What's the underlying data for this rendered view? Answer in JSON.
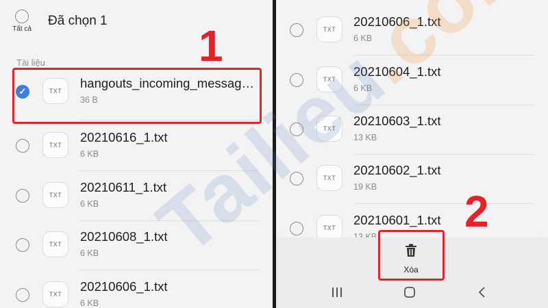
{
  "left": {
    "select_all_label": "Tất cả",
    "header_title": "Đã chọn 1",
    "section_label": "Tài liệu",
    "files": [
      {
        "name": "hangouts_incoming_messag…",
        "size": "36 B",
        "selected": true,
        "type": "TXT"
      },
      {
        "name": "20210616_1.txt",
        "size": "6 KB",
        "selected": false,
        "type": "TXT"
      },
      {
        "name": "20210611_1.txt",
        "size": "6 KB",
        "selected": false,
        "type": "TXT"
      },
      {
        "name": "20210608_1.txt",
        "size": "6 KB",
        "selected": false,
        "type": "TXT"
      },
      {
        "name": "20210606_1.txt",
        "size": "6 KB",
        "selected": false,
        "type": "TXT"
      }
    ]
  },
  "right": {
    "files": [
      {
        "name": "20210606_1.txt",
        "size": "6 KB",
        "type": "TXT"
      },
      {
        "name": "20210604_1.txt",
        "size": "6 KB",
        "type": "TXT"
      },
      {
        "name": "20210603_1.txt",
        "size": "13 KB",
        "type": "TXT"
      },
      {
        "name": "20210602_1.txt",
        "size": "19 KB",
        "type": "TXT"
      },
      {
        "name": "20210601_1.txt",
        "size": "13 KB",
        "type": "TXT"
      }
    ],
    "delete_label": "Xóa"
  },
  "annotations": {
    "step1": "1",
    "step2": "2",
    "highlight_color": "#e5212a"
  },
  "watermark": {
    "text_main": "Tailieu",
    "text_accent": ".com"
  },
  "icons": {
    "check": "check-icon",
    "delete": "trash-icon",
    "nav_recents": "recents-icon",
    "nav_home": "home-icon",
    "nav_back": "back-icon"
  },
  "colors": {
    "accent": "#3b7de0",
    "panel_bg": "#f3f3f3"
  }
}
